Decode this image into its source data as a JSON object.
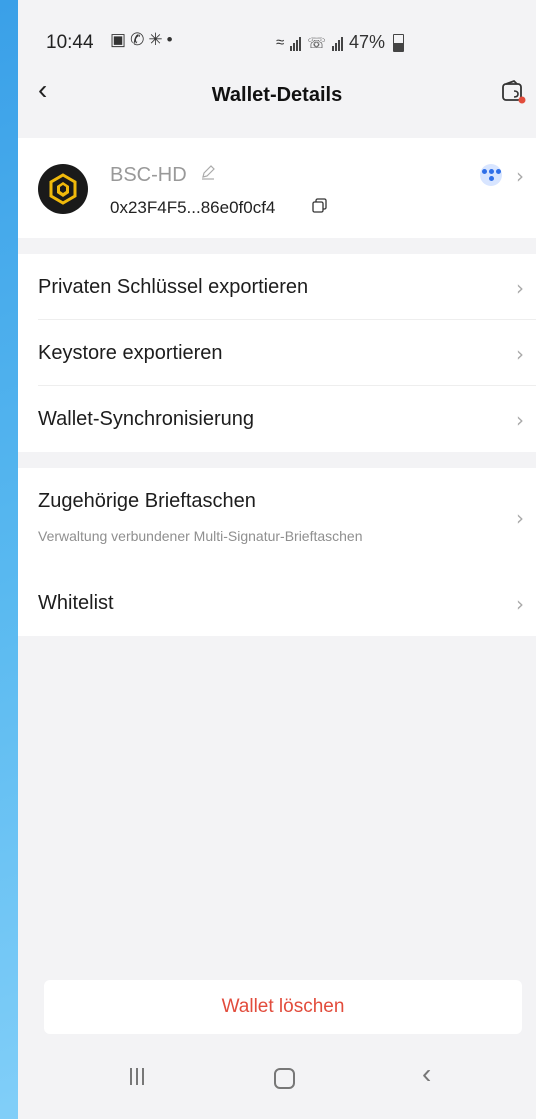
{
  "status_bar": {
    "time": "10:44",
    "battery": "47%",
    "left_icons": [
      "gallery-icon",
      "whatsapp-icon",
      "walk-icon",
      "dot"
    ],
    "right_icons": [
      "wifi-icon",
      "signal-icon",
      "call-signal-icon",
      "battery-icon"
    ]
  },
  "header": {
    "title": "Wallet-Details",
    "back_icon": "chevron-left-icon",
    "wallet_icon": "wallet-icon"
  },
  "wallet": {
    "name": "BSC-HD",
    "address": "0x23F4F5...86e0f0cf4",
    "logo": "bnb-logo"
  },
  "menu_group_1": [
    {
      "label": "Privaten Schlüssel exportieren"
    },
    {
      "label": "Keystore exportieren"
    },
    {
      "label": "Wallet-Synchronisierung"
    }
  ],
  "menu_group_2": [
    {
      "label": "Zugehörige Brieftaschen",
      "sub": "Verwaltung verbundener Multi-Signatur-Brieftaschen"
    },
    {
      "label": "Whitelist"
    }
  ],
  "delete_label": "Wallet löschen",
  "colors": {
    "accent_red": "#e24c3c",
    "accent_blue": "#2f6fe8",
    "bnb_yellow": "#f0b90b",
    "background": "#f3f3f5"
  }
}
